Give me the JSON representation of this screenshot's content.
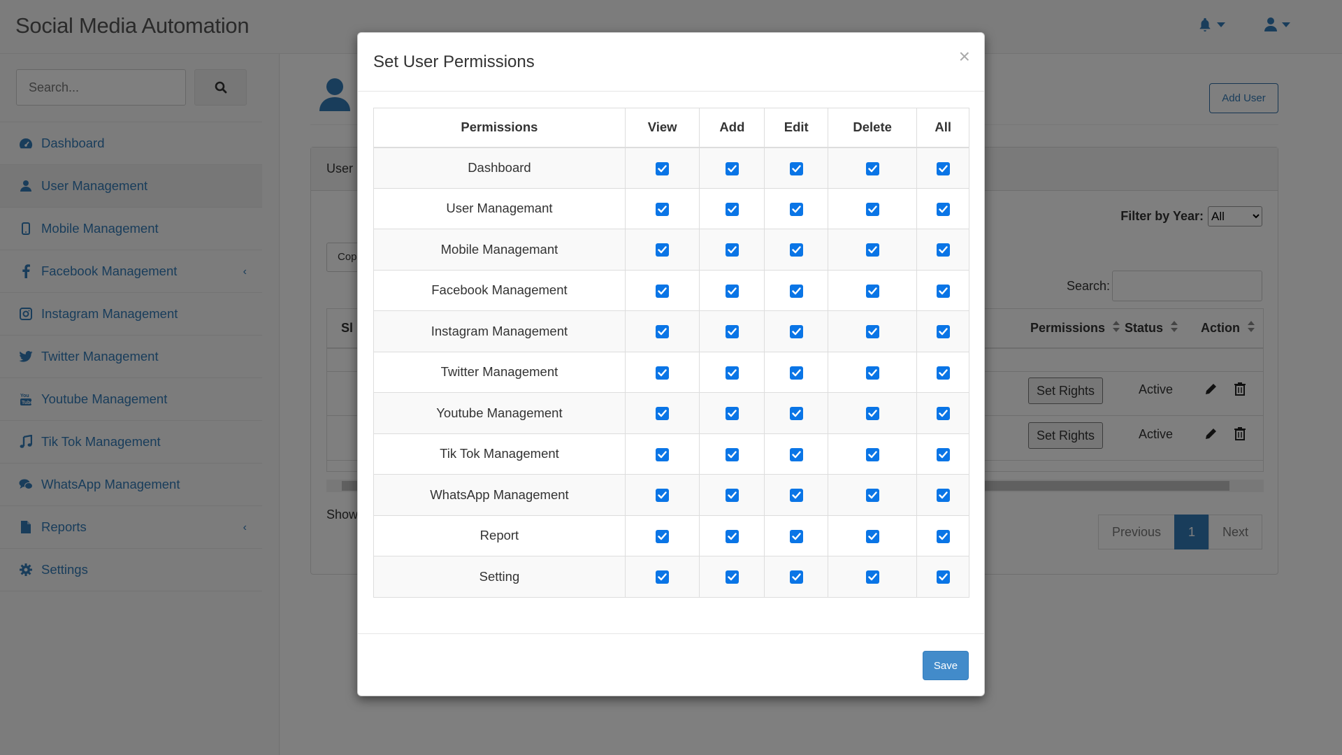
{
  "app": {
    "brand": "Social Media Automation"
  },
  "sidebar": {
    "search_placeholder": "Search...",
    "items": [
      {
        "label": "Dashboard",
        "icon": "dashboard-icon"
      },
      {
        "label": "User Management",
        "icon": "user-icon",
        "active": true
      },
      {
        "label": "Mobile Management",
        "icon": "mobile-icon"
      },
      {
        "label": "Facebook Management",
        "icon": "facebook-icon",
        "has_submenu": true
      },
      {
        "label": "Instagram Management",
        "icon": "instagram-icon"
      },
      {
        "label": "Twitter Management",
        "icon": "twitter-icon"
      },
      {
        "label": "Youtube Management",
        "icon": "youtube-icon"
      },
      {
        "label": "Tik Tok Management",
        "icon": "music-icon"
      },
      {
        "label": "WhatsApp Management",
        "icon": "chat-icon"
      },
      {
        "label": "Reports",
        "icon": "file-icon",
        "has_submenu": true
      },
      {
        "label": "Settings",
        "icon": "gear-icon"
      }
    ]
  },
  "main": {
    "add_user_label": "Add User",
    "panel_title": "User",
    "filter_label": "Filter by Year:",
    "filter_value": "All",
    "copy_label": "Cop",
    "search_label": "Search:",
    "table": {
      "headers": {
        "sl": "Sl",
        "permissions": "Permissions",
        "status": "Status",
        "action": "Action"
      },
      "rows": [
        {
          "permissions_btn": "Set Rights",
          "status": "Active"
        },
        {
          "permissions_btn": "Set Rights",
          "status": "Active"
        }
      ]
    },
    "show_text": "Show",
    "pagination": {
      "previous": "Previous",
      "current": "1",
      "next": "Next"
    }
  },
  "modal": {
    "title": "Set User Permissions",
    "close_glyph": "×",
    "columns": [
      "Permissions",
      "View",
      "Add",
      "Edit",
      "Delete",
      "All"
    ],
    "rows": [
      {
        "name": "Dashboard",
        "view": true,
        "add": true,
        "edit": true,
        "delete": true,
        "all": true
      },
      {
        "name": "User Managemant",
        "view": true,
        "add": true,
        "edit": true,
        "delete": true,
        "all": true
      },
      {
        "name": "Mobile Managemant",
        "view": true,
        "add": true,
        "edit": true,
        "delete": true,
        "all": true
      },
      {
        "name": "Facebook Management",
        "view": true,
        "add": true,
        "edit": true,
        "delete": true,
        "all": true
      },
      {
        "name": "Instagram Management",
        "view": true,
        "add": true,
        "edit": true,
        "delete": true,
        "all": true
      },
      {
        "name": "Twitter Management",
        "view": true,
        "add": true,
        "edit": true,
        "delete": true,
        "all": true
      },
      {
        "name": "Youtube Management",
        "view": true,
        "add": true,
        "edit": true,
        "delete": true,
        "all": true
      },
      {
        "name": "Tik Tok Management",
        "view": true,
        "add": true,
        "edit": true,
        "delete": true,
        "all": true
      },
      {
        "name": "WhatsApp Management",
        "view": true,
        "add": true,
        "edit": true,
        "delete": true,
        "all": true
      },
      {
        "name": "Report",
        "view": true,
        "add": true,
        "edit": true,
        "delete": true,
        "all": true
      },
      {
        "name": "Setting",
        "view": true,
        "add": true,
        "edit": true,
        "delete": true,
        "all": true
      }
    ],
    "save_label": "Save"
  },
  "colors": {
    "accent": "#337ab7",
    "checkbox": "#0a75e6",
    "save": "#428bca"
  }
}
